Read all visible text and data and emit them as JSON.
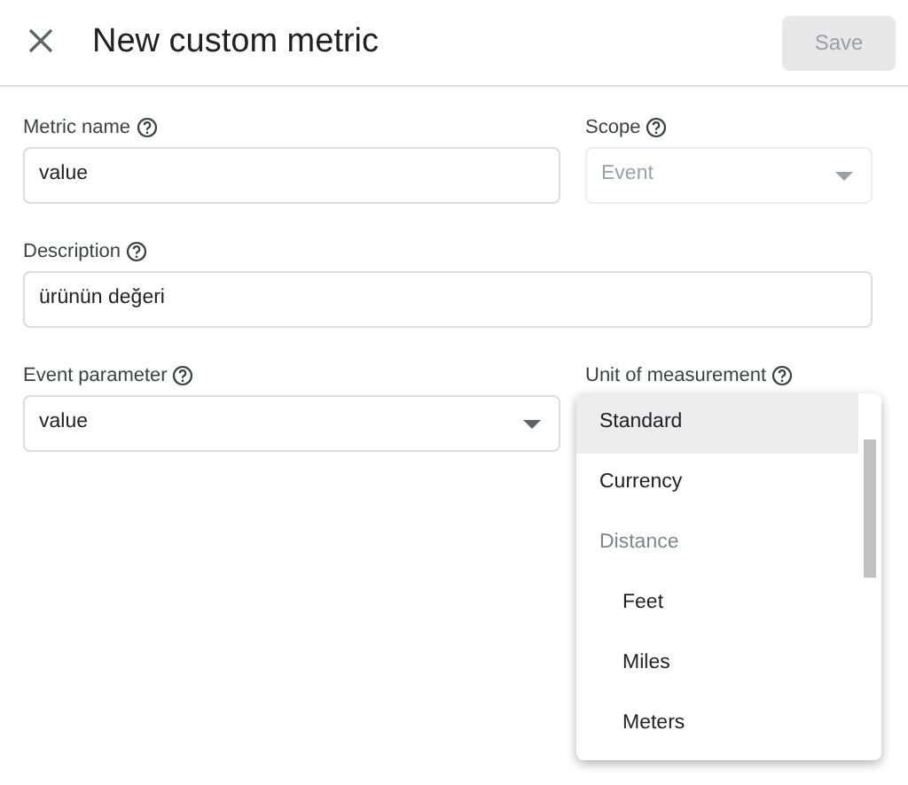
{
  "header": {
    "title": "New custom metric",
    "save_button": {
      "label": "Save",
      "disabled": true
    }
  },
  "fields": [
    {
      "label": "Metric name",
      "kind": "text",
      "value": "value"
    },
    {
      "label": "Scope",
      "kind": "select",
      "value": "Event",
      "disabled": true
    },
    {
      "label": "Description",
      "kind": "text",
      "value": "ürünün değeri"
    },
    {
      "label": "Event parameter",
      "kind": "select",
      "value": "value"
    },
    {
      "label": "Unit of measurement",
      "kind": "menu"
    }
  ],
  "unit_menu": [
    {
      "label": "Standard",
      "kind": "option",
      "selected": true
    },
    {
      "label": "Currency",
      "kind": "option",
      "selected": false
    },
    {
      "label": "Distance",
      "kind": "group",
      "children": [
        {
          "label": "Feet",
          "kind": "option",
          "selected": false
        },
        {
          "label": "Miles",
          "kind": "option",
          "selected": false
        },
        {
          "label": "Meters",
          "kind": "option",
          "selected": false
        }
      ]
    }
  ]
}
